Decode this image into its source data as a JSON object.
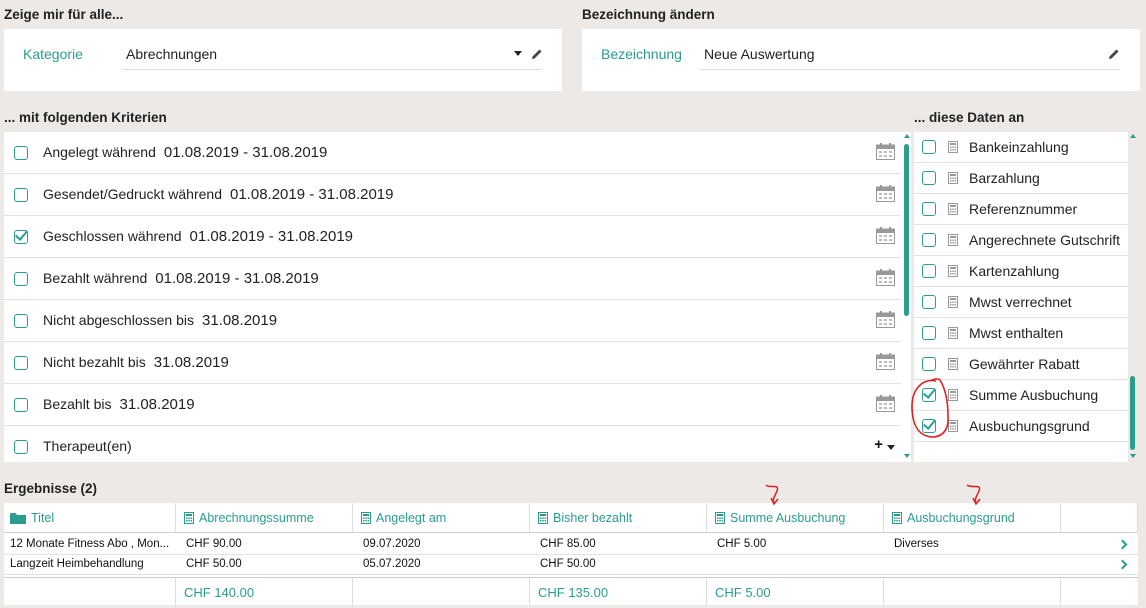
{
  "sections": {
    "show_for_all": "Zeige mir für alle...",
    "rename": "Bezeichnung ändern",
    "criteria": "... mit folgenden Kriterien",
    "data": "... diese Daten an",
    "results": "Ergebnisse (2)"
  },
  "category": {
    "label": "Kategorie",
    "value": "Abrechnungen"
  },
  "name": {
    "label": "Bezeichnung",
    "value": "Neue Auswertung"
  },
  "criteria": [
    {
      "label": "Angelegt während",
      "value": "01.08.2019 - 31.08.2019",
      "checked": false,
      "icon": "calendar-icon"
    },
    {
      "label": "Gesendet/Gedruckt während",
      "value": "01.08.2019 - 31.08.2019",
      "checked": false,
      "icon": "calendar-icon"
    },
    {
      "label": "Geschlossen während",
      "value": "01.08.2019 - 31.08.2019",
      "checked": true,
      "icon": "calendar-icon"
    },
    {
      "label": "Bezahlt während",
      "value": "01.08.2019 - 31.08.2019",
      "checked": false,
      "icon": "calendar-icon"
    },
    {
      "label": "Nicht abgeschlossen bis",
      "value": "31.08.2019",
      "checked": false,
      "icon": "calendar-icon"
    },
    {
      "label": "Nicht bezahlt bis",
      "value": "31.08.2019",
      "checked": false,
      "icon": "calendar-icon"
    },
    {
      "label": "Bezahlt bis",
      "value": "31.08.2019",
      "checked": false,
      "icon": "calendar-icon"
    },
    {
      "label": "Therapeut(en)",
      "value": "",
      "checked": false,
      "icon": "plus-dropdown-icon"
    }
  ],
  "data_fields": [
    {
      "label": "Bankeinzahlung",
      "checked": false
    },
    {
      "label": "Barzahlung",
      "checked": false
    },
    {
      "label": "Referenznummer",
      "checked": false
    },
    {
      "label": "Angerechnete Gutschrift",
      "checked": false
    },
    {
      "label": "Kartenzahlung",
      "checked": false
    },
    {
      "label": "Mwst verrechnet",
      "checked": false
    },
    {
      "label": "Mwst enthalten",
      "checked": false
    },
    {
      "label": "Gewährter Rabatt",
      "checked": false
    },
    {
      "label": "Summe Ausbuchung",
      "checked": true
    },
    {
      "label": "Ausbuchungsgrund",
      "checked": true
    }
  ],
  "results": {
    "columns": [
      "Titel",
      "Abrechnungssumme",
      "Angelegt am",
      "Bisher bezahlt",
      "Summe Ausbuchung",
      "Ausbuchungsgrund"
    ],
    "rows": [
      [
        "12 Monate Fitness Abo , Mon...",
        "CHF 90.00",
        "09.07.2020",
        "CHF 85.00",
        "CHF 5.00",
        "Diverses"
      ],
      [
        "Langzeit Heimbehandlung",
        "CHF 50.00",
        "05.07.2020",
        "CHF 50.00",
        "",
        ""
      ]
    ],
    "totals": [
      "",
      "CHF 140.00",
      "",
      "CHF 135.00",
      "CHF 5.00",
      ""
    ]
  },
  "colors": {
    "accent": "#2a9d8f",
    "annotation": "#e02020"
  }
}
